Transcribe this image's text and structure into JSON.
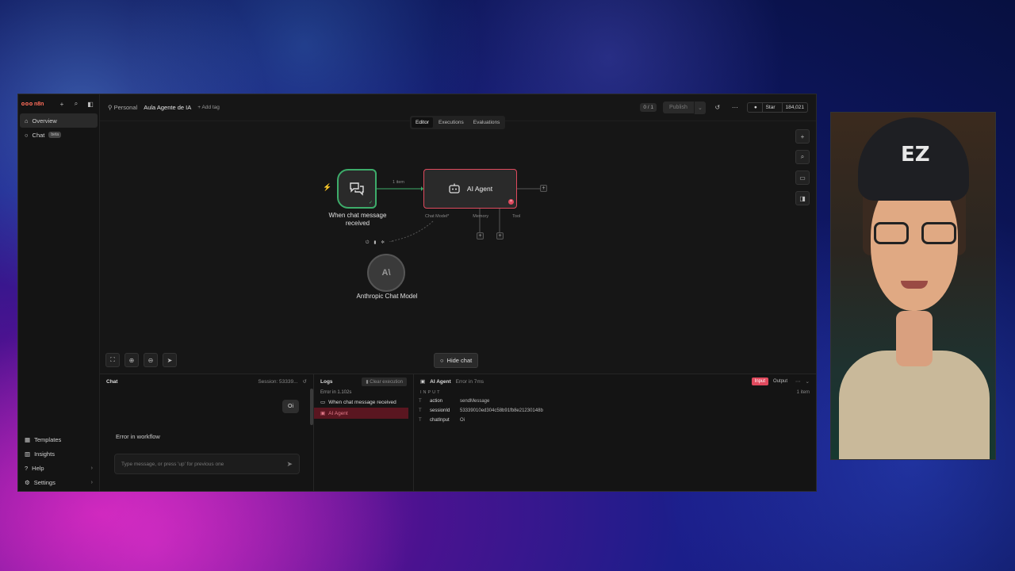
{
  "sidebar": {
    "logo": "n8n",
    "items": [
      {
        "label": "Overview"
      },
      {
        "label": "Chat",
        "badge": "beta"
      }
    ],
    "bottom_items": [
      {
        "label": "Templates"
      },
      {
        "label": "Insights"
      },
      {
        "label": "Help"
      },
      {
        "label": "Settings"
      }
    ]
  },
  "header": {
    "scope": "Personal",
    "workflow_name": "Aula Agente de IA",
    "add_tag": "+ Add tag",
    "counter": "0 / 1",
    "publish_label": "Publish",
    "star_label": "Star",
    "star_count": "184,021"
  },
  "tabs": [
    {
      "label": "Editor",
      "active": true
    },
    {
      "label": "Executions"
    },
    {
      "label": "Evaluations"
    }
  ],
  "canvas": {
    "trigger_label": "When chat message received",
    "connection_label": "1 item",
    "agent_label": "AI Agent",
    "sub_connections": [
      "Chat Model*",
      "Memory",
      "Tool"
    ],
    "model_label": "Anthropic Chat Model",
    "model_glyph": "A\\",
    "hide_chat_label": "Hide chat"
  },
  "chat": {
    "title": "Chat",
    "session": "Session: 53339...",
    "user_message": "Oi",
    "error_text": "Error in workflow",
    "input_placeholder": "Type message, or press 'up' for previous one"
  },
  "logs": {
    "title": "Logs",
    "clear_label": "Clear execution",
    "summary": "Error in 1.102s",
    "items": [
      {
        "label": "When chat message received"
      },
      {
        "label": "AI Agent",
        "status": "error"
      }
    ]
  },
  "io": {
    "node": "AI Agent",
    "status": "Error in 7ms",
    "input_tab": "Input",
    "output_tab": "Output",
    "item_count": "1 item",
    "section": "INPUT",
    "fields": [
      {
        "key": "action",
        "value": "sendMessage"
      },
      {
        "key": "sessionId",
        "value": "53339010ed304c58b91fb8e21230148b"
      },
      {
        "key": "chatInput",
        "value": "Oi"
      }
    ]
  },
  "colors": {
    "accent": "#ff6d5a",
    "success": "#3dac6a",
    "error": "#e04a5e"
  },
  "webcam": {
    "cap_text": "EZ"
  }
}
